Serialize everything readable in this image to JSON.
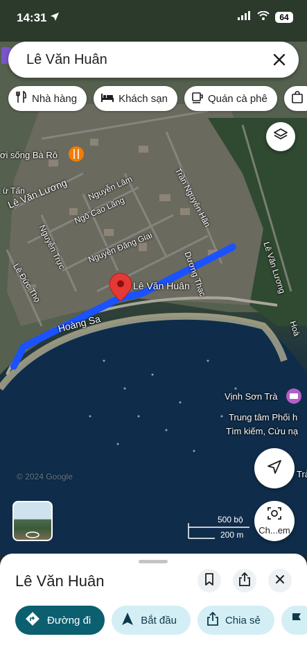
{
  "status_bar": {
    "time": "14:31",
    "battery": "64"
  },
  "search": {
    "query": "Lê Văn Huân"
  },
  "chips": [
    {
      "label": "Nhà hàng",
      "icon": "fork-knife-icon"
    },
    {
      "label": "Khách sạn",
      "icon": "bed-icon"
    },
    {
      "label": "Quán cà phê",
      "icon": "coffee-icon"
    },
    {
      "label": "",
      "icon": "shopping-bag-icon"
    }
  ],
  "map": {
    "pin_label": "Lê Văn Huân",
    "streets": {
      "le_van_luong_w": "Lê Văn Lương",
      "nguyen_truc": "Nguyễn Trực",
      "nguyen_lam": "Nguyễn Lâm",
      "ngo_cao_lang": "Ngô Cao Lãng",
      "nguyen_dang_giai": "Nguyễn Đăng Giai",
      "tran_nguyen_han": "Trần Nguyên Hãn",
      "duong_thac": "Dương Thạc",
      "le_van_luong_e": "Lê Văn Lương",
      "le_duc_tho": "Lê Đức Thọ",
      "hoang_sa": "Hoàng Sa",
      "tu_tan": "ừ Tấn",
      "hoa": "Hoà"
    },
    "pois": {
      "restaurant": "ơi sống Bà Rô",
      "bay": "Vịnh Sơn Trà",
      "center_line1": "Trung tâm Phối h",
      "center_line2": "Tìm kiếm, Cứu nạ",
      "tra": "Trà"
    },
    "watermark": "© 2024 Google",
    "scale_ft": "500 bộ",
    "scale_m": "200 m",
    "lens_label": "Ch...em"
  },
  "sheet": {
    "title": "Lê Văn Huân",
    "actions": [
      {
        "label": "Đường đi",
        "icon": "directions-icon"
      },
      {
        "label": "Bắt đầu",
        "icon": "navigation-arrow-icon"
      },
      {
        "label": "Chia sẻ",
        "icon": "share-icon"
      },
      {
        "label": "",
        "icon": "flag-icon"
      }
    ]
  },
  "colors": {
    "route": "#1a52ff",
    "pin": "#e53935",
    "primary_action": "#0b5f6f",
    "secondary_action": "#d4eef5"
  }
}
